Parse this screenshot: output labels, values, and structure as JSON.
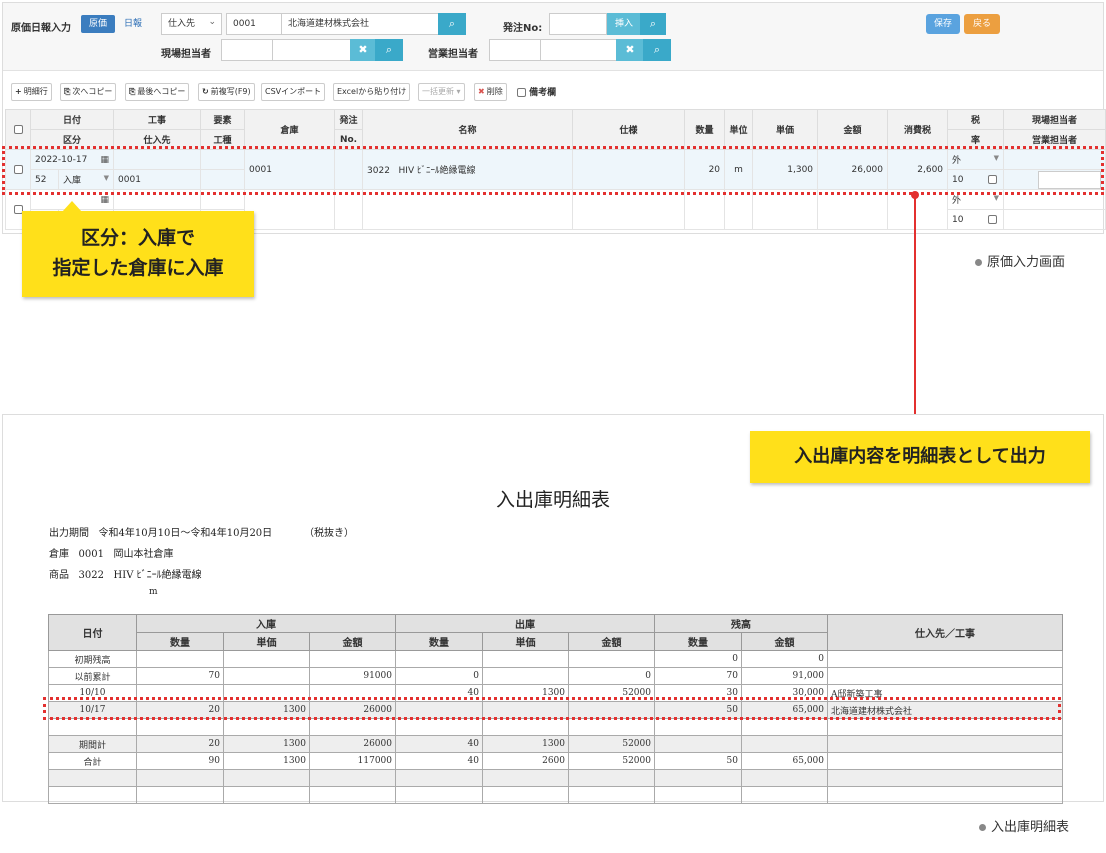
{
  "screen": {
    "title": "原価日報入力",
    "mode_cost": "原価",
    "mode_daily": "日報",
    "supplier_select": "仕入先",
    "supplier_code": "0001",
    "supplier_name": "北海道建材株式会社",
    "order_no_label": "発注No:",
    "insert_label": "挿入",
    "site_manager_label": "現場担当者",
    "sales_manager_label": "営業担当者",
    "save_label": "保存",
    "back_label": "戻る"
  },
  "toolbar": [
    {
      "icon": "+",
      "label": "明細行"
    },
    {
      "icon": "⎘",
      "label": "次へコピー"
    },
    {
      "icon": "⎘",
      "label": "最後へコピー"
    },
    {
      "icon": "↻",
      "label": "前複写(F9)"
    },
    {
      "icon": "",
      "label": "CSVインポート"
    },
    {
      "icon": "",
      "label": "Excelから貼り付け"
    },
    {
      "icon": "",
      "label": "一括更新 ▾"
    },
    {
      "icon": "✖",
      "label": "削除"
    },
    {
      "icon": "",
      "label": "備考欄"
    }
  ],
  "grid": {
    "headers": {
      "date": "日付",
      "type": "区分",
      "work": "工事",
      "supplier": "仕入先",
      "element": "要素",
      "work_type": "工種",
      "warehouse": "倉庫",
      "order": "発注",
      "order_no": "No.",
      "name": "名称",
      "spec": "仕様",
      "qty": "数量",
      "unit": "単位",
      "unit_price": "単価",
      "amount": "金額",
      "tax": "消費税",
      "tax_col": "税",
      "rate": "率",
      "site_mgr": "現場担当者",
      "sales_mgr": "営業担当者"
    },
    "row1": {
      "date": "2022-10-17",
      "no": "52",
      "type": "入庫",
      "work": "0001",
      "warehouse": "0001",
      "item_code": "3022",
      "name": "HIV ﾋﾞﾆｰﾙ絶縁電線",
      "qty": "20",
      "unit": "m",
      "unit_price": "1,300",
      "amount": "26,000",
      "tax": "2,600",
      "tax_type": "外",
      "rate": "10"
    },
    "row2": {
      "tax_type": "外",
      "rate": "10"
    }
  },
  "callout_left": {
    "line1": "区分：入庫で",
    "line2": "指定した倉庫に入庫"
  },
  "callout_right": "入出庫内容を明細表として出力",
  "caption_screen": "原価入力画面",
  "caption_report": "入出庫明細表",
  "report": {
    "title": "入出庫明細表",
    "period_label": "出力期間",
    "period_value": "令和4年10月10日～令和4年10月20日",
    "tax_note": "（税抜き）",
    "warehouse_label": "倉庫",
    "warehouse_code": "0001",
    "warehouse_name": "岡山本社倉庫",
    "item_label": "商品",
    "item_code": "3022",
    "item_name": "HIV ﾋﾞﾆｰﾙ絶縁電線",
    "item_unit": "m",
    "headers": {
      "date": "日付",
      "in": "入庫",
      "out": "出庫",
      "bal": "残高",
      "qty": "数量",
      "price": "単価",
      "amount": "金額",
      "supplier": "仕入先／工事"
    },
    "rows": [
      {
        "date": "初期残高",
        "iq": "",
        "ip": "",
        "ia": "",
        "oq": "",
        "op": "",
        "oa": "",
        "bq": "0",
        "ba": "0",
        "s": ""
      },
      {
        "date": "以前累計",
        "iq": "70",
        "ip": "",
        "ia": "91000",
        "oq": "0",
        "op": "",
        "oa": "0",
        "bq": "70",
        "ba": "91,000",
        "s": ""
      },
      {
        "date": "10/10",
        "iq": "",
        "ip": "",
        "ia": "",
        "oq": "40",
        "op": "1300",
        "oa": "52000",
        "bq": "30",
        "ba": "30,000",
        "s": "A邸新築工事"
      },
      {
        "date": "10/17",
        "iq": "20",
        "ip": "1300",
        "ia": "26000",
        "oq": "",
        "op": "",
        "oa": "",
        "bq": "50",
        "ba": "65,000",
        "s": "北海道建材株式会社"
      },
      {
        "date": "",
        "iq": "",
        "ip": "",
        "ia": "",
        "oq": "",
        "op": "",
        "oa": "",
        "bq": "",
        "ba": "",
        "s": ""
      },
      {
        "date": "期間計",
        "iq": "20",
        "ip": "1300",
        "ia": "26000",
        "oq": "40",
        "op": "1300",
        "oa": "52000",
        "bq": "",
        "ba": "",
        "s": ""
      },
      {
        "date": "合計",
        "iq": "90",
        "ip": "1300",
        "ia": "117000",
        "oq": "40",
        "op": "2600",
        "oa": "52000",
        "bq": "50",
        "ba": "65,000",
        "s": ""
      },
      {
        "date": "",
        "iq": "",
        "ip": "",
        "ia": "",
        "oq": "",
        "op": "",
        "oa": "",
        "bq": "",
        "ba": "",
        "s": ""
      },
      {
        "date": "",
        "iq": "",
        "ip": "",
        "ia": "",
        "oq": "",
        "op": "",
        "oa": "",
        "bq": "",
        "ba": "",
        "s": ""
      }
    ]
  },
  "colors": {
    "highlight": "#e3302f",
    "callout": "#ffe01a",
    "primary": "#3b7dbf",
    "search": "#5bbcd6"
  }
}
